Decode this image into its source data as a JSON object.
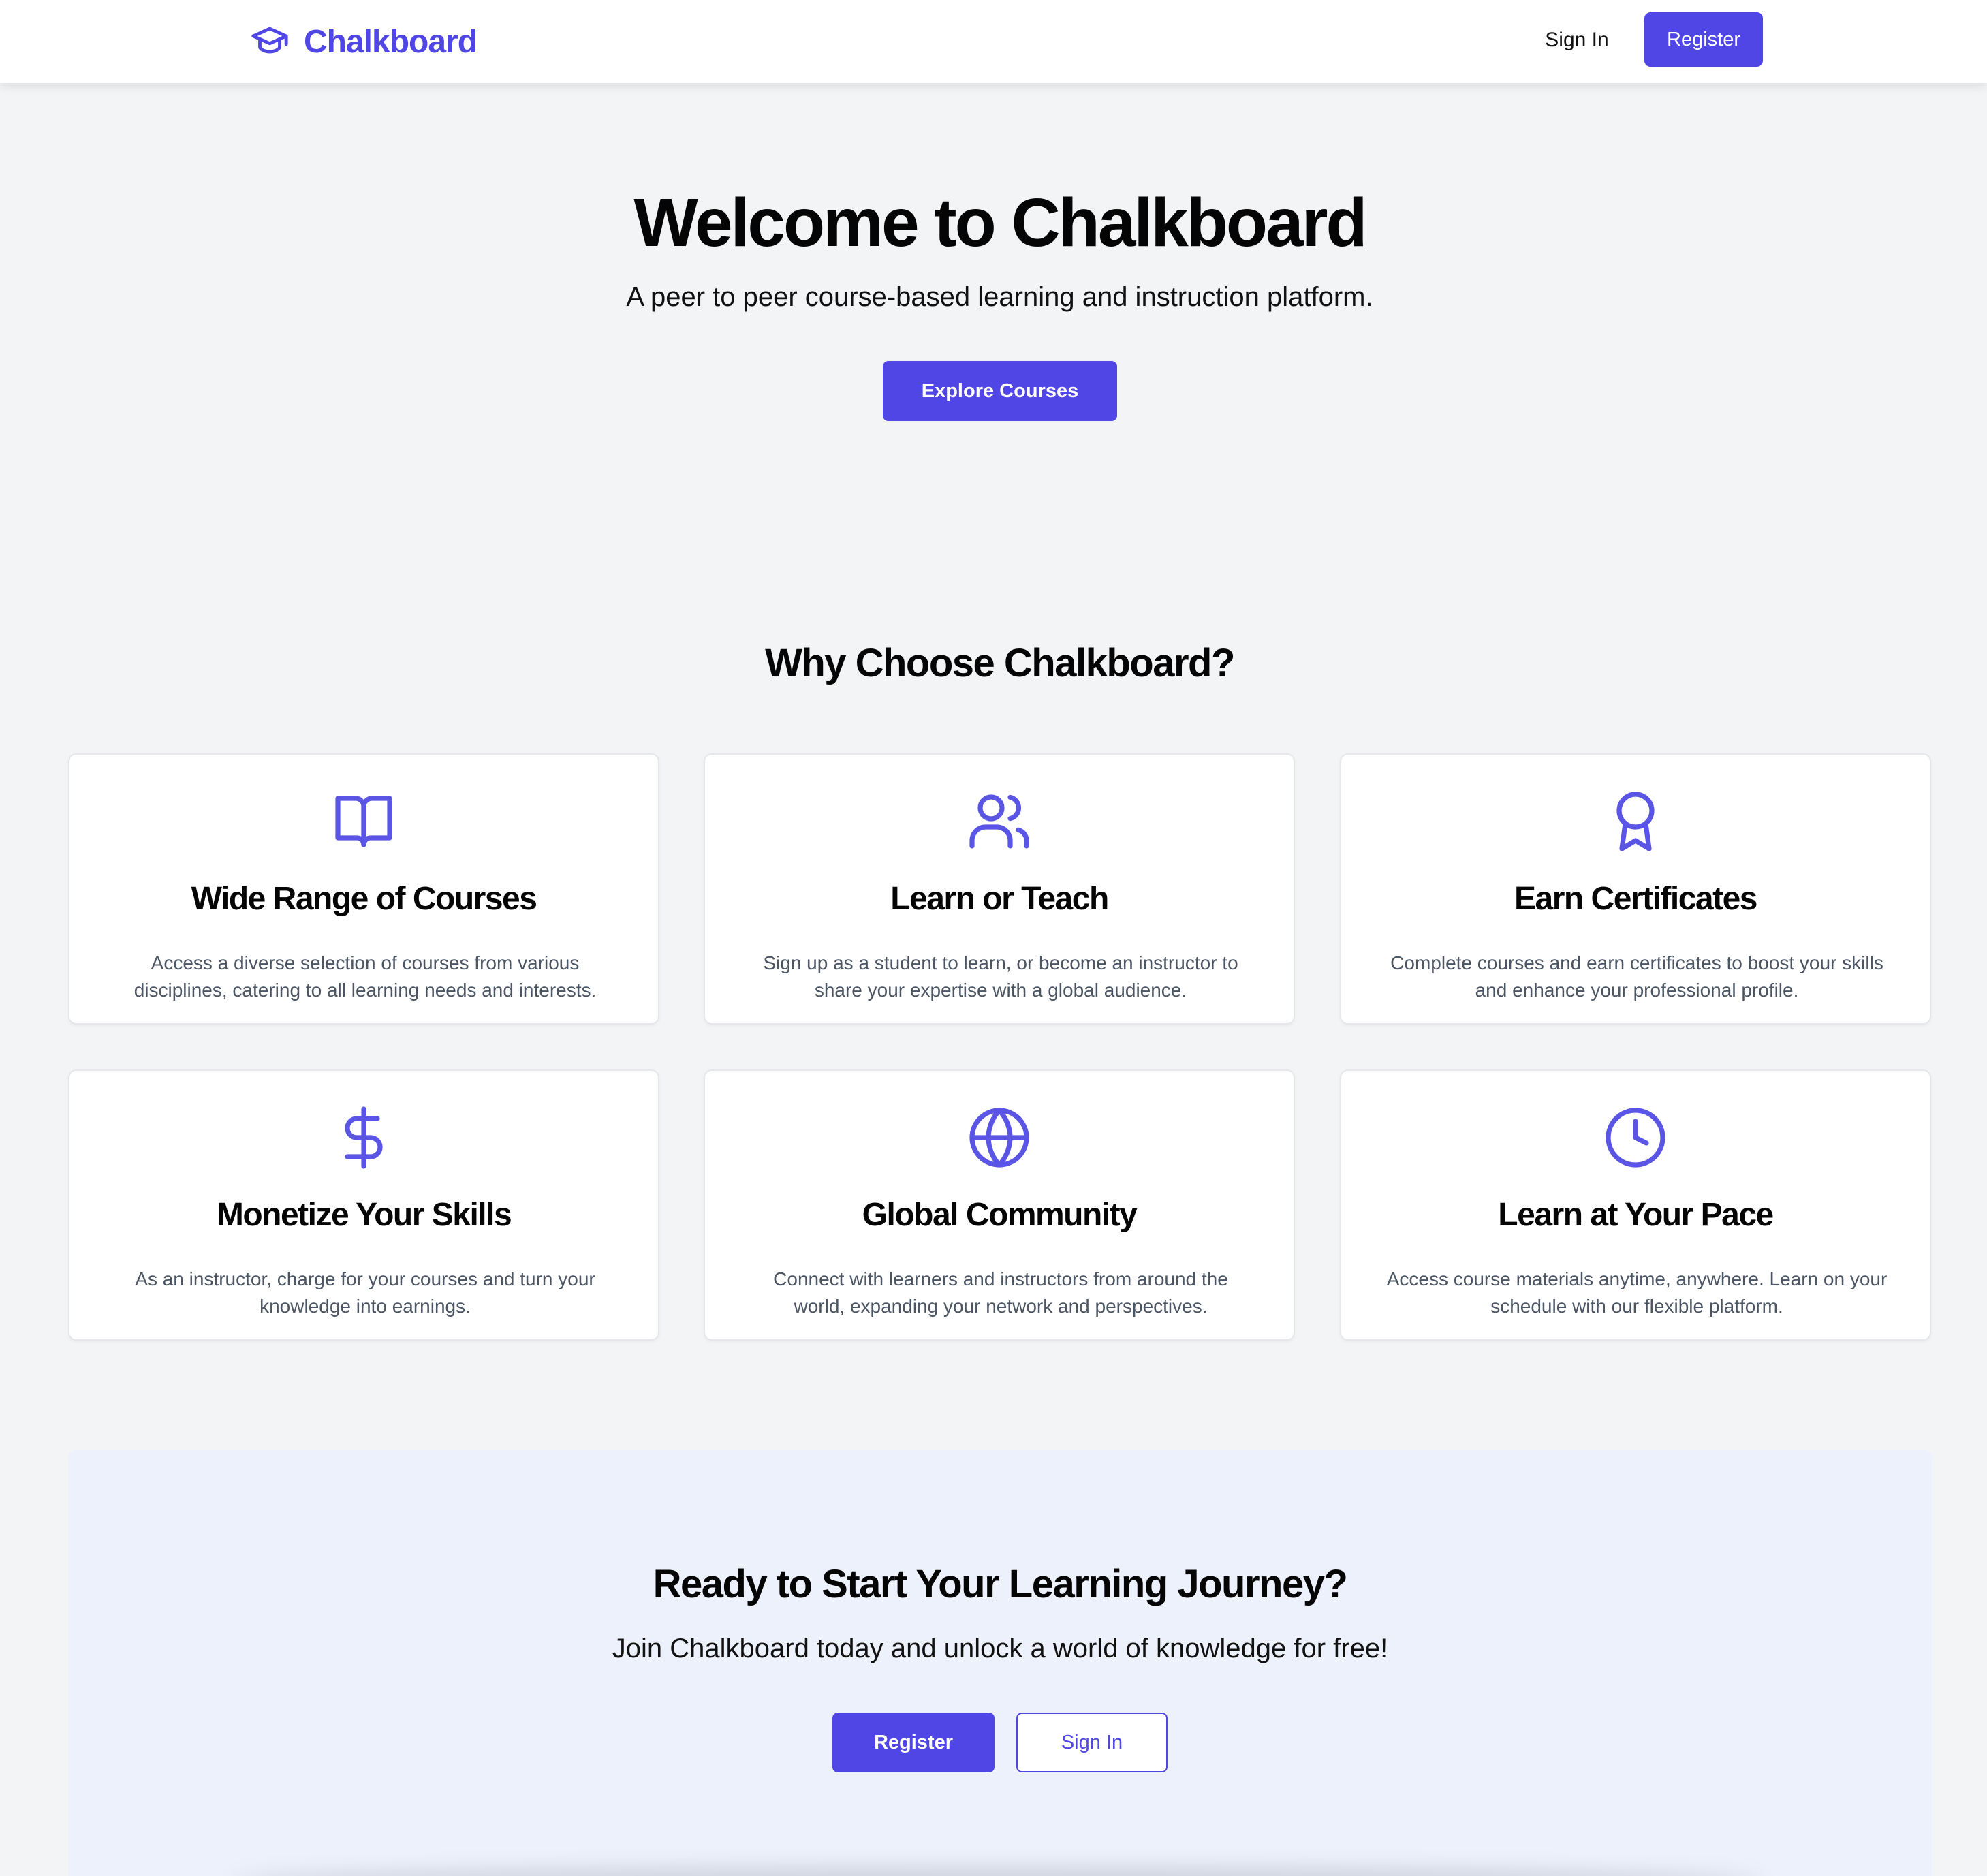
{
  "colors": {
    "accent": "#4f46e5",
    "page_bg": "#f3f4f6",
    "card_bg": "#ffffff",
    "cta_bg": "#edf1fc",
    "muted_text": "#4b5563"
  },
  "header": {
    "brand_name": "Chalkboard",
    "brand_icon": "graduation-cap-icon",
    "signin_label": "Sign In",
    "register_label": "Register"
  },
  "hero": {
    "title": "Welcome to Chalkboard",
    "subtitle": "A peer to peer course-based learning and instruction platform.",
    "button_label": "Explore Courses"
  },
  "features": {
    "title": "Why Choose Chalkboard?",
    "items": [
      {
        "icon": "book-open-icon",
        "title": "Wide Range of Courses",
        "description": "Access a diverse selection of courses from various disciplines, catering to all learning needs and interests."
      },
      {
        "icon": "users-icon",
        "title": "Learn or Teach",
        "description": "Sign up as a student to learn, or become an instructor to share your expertise with a global audience."
      },
      {
        "icon": "award-icon",
        "title": "Earn Certificates",
        "description": "Complete courses and earn certificates to boost your skills and enhance your professional profile."
      },
      {
        "icon": "dollar-sign-icon",
        "title": "Monetize Your Skills",
        "description": "As an instructor, charge for your courses and turn your knowledge into earnings."
      },
      {
        "icon": "globe-icon",
        "title": "Global Community",
        "description": "Connect with learners and instructors from around the world, expanding your network and perspectives."
      },
      {
        "icon": "clock-icon",
        "title": "Learn at Your Pace",
        "description": "Access course materials anytime, anywhere. Learn on your schedule with our flexible platform."
      }
    ]
  },
  "cta": {
    "title": "Ready to Start Your Learning Journey?",
    "subtitle": "Join Chalkboard today and unlock a world of knowledge for free!",
    "register_label": "Register",
    "signin_label": "Sign In"
  }
}
